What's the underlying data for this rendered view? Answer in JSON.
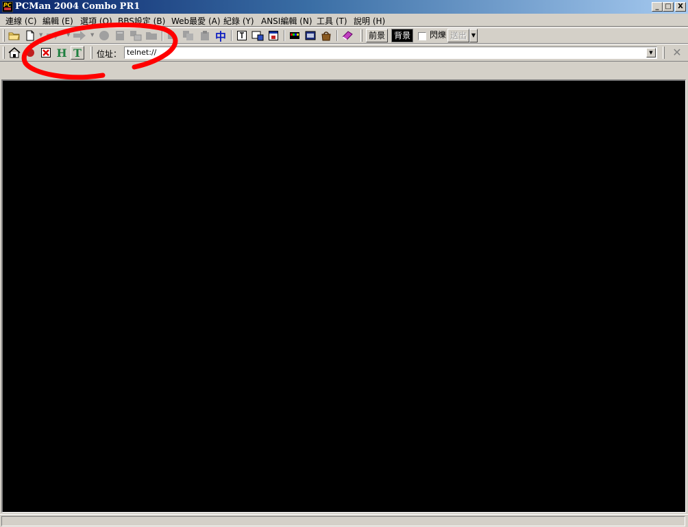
{
  "window": {
    "title": "PCMan 2004 Combo PR1",
    "icon_text": "PC",
    "controls": {
      "minimize": "_",
      "maximize": "□",
      "close": "X"
    }
  },
  "menu": [
    {
      "label": "連線 (C)"
    },
    {
      "label": "編輯 (E)"
    },
    {
      "label": "選項 (O)"
    },
    {
      "label": "BBS設定 (B)"
    },
    {
      "label": "Web最愛 (A)"
    },
    {
      "label": "紀錄 (Y)"
    },
    {
      "label": "ANSI編輯 (N)"
    },
    {
      "label": "工具 (T)"
    },
    {
      "label": "說明 (H)"
    }
  ],
  "toolbar": {
    "chinese_label": "中",
    "foreground_label": "前景",
    "background_label": "背景",
    "blink_label": "閃爍",
    "send_label": "送出"
  },
  "address_bar": {
    "label": "位址：",
    "value": "telnet://",
    "h_label": "H",
    "t_label": "T",
    "close_label": "✕"
  },
  "colors": {
    "terminal_background": "#000000",
    "annotation_red": "#ff0000",
    "title_gradient_start": "#0a246a"
  },
  "icons": [
    "open-folder-icon",
    "new-document-icon",
    "dropdown-arrow-icon",
    "connect-arrow-icon",
    "disconnect-icon",
    "reconnect-icon",
    "favorites-icon",
    "copy-icon",
    "paste-icon",
    "chinese-input-icon",
    "text-icon",
    "table-icon",
    "window-icon",
    "color-palette-icon",
    "keyboard-icon",
    "bag-icon",
    "book-icon",
    "home-icon",
    "stop-icon",
    "close-page-icon"
  ]
}
